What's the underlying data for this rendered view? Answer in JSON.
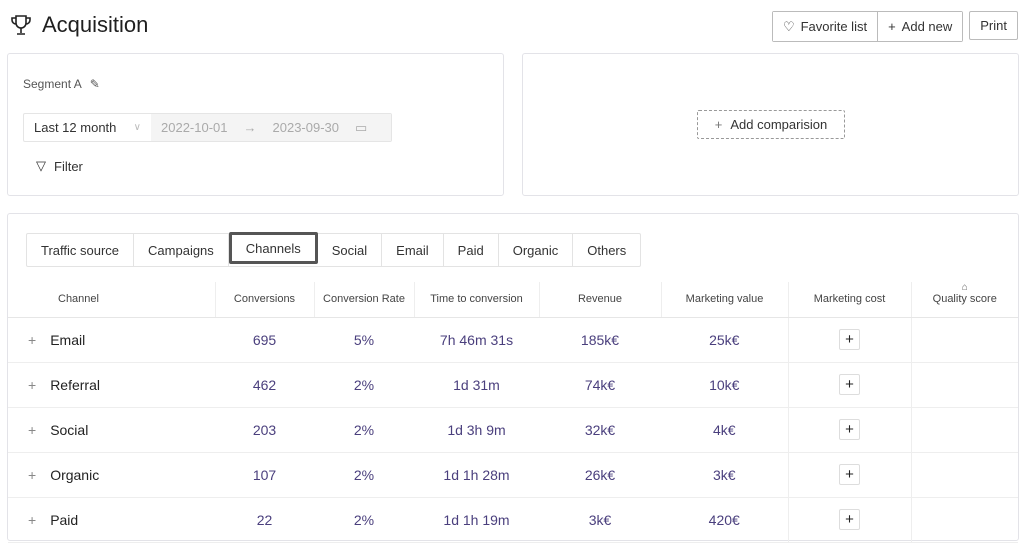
{
  "header": {
    "title": "Acquisition",
    "favorite_label": "Favorite list",
    "add_new_label": "Add new",
    "print_label": "Print"
  },
  "segment": {
    "label": "Segment A",
    "period": "Last 12 month",
    "date_from": "2022-10-01",
    "date_to": "2023-09-30",
    "filter_label": "Filter"
  },
  "comparison": {
    "add_label": "Add comparision"
  },
  "tabs": [
    "Traffic source",
    "Campaigns",
    "Channels",
    "Social",
    "Email",
    "Paid",
    "Organic",
    "Others"
  ],
  "active_tab": "Channels",
  "table": {
    "columns": [
      "Channel",
      "Conversions",
      "Conversion Rate",
      "Time to conversion",
      "Revenue",
      "Marketing value",
      "Marketing cost",
      "Quality score"
    ],
    "rows": [
      {
        "channel": "Email",
        "conversions": "695",
        "rate": "5%",
        "time": "7h 46m 31s",
        "revenue": "185k€",
        "value": "25k€"
      },
      {
        "channel": "Referral",
        "conversions": "462",
        "rate": "2%",
        "time": "1d 31m",
        "revenue": "74k€",
        "value": "10k€"
      },
      {
        "channel": "Social",
        "conversions": "203",
        "rate": "2%",
        "time": "1d 3h 9m",
        "revenue": "32k€",
        "value": "4k€"
      },
      {
        "channel": "Organic",
        "conversions": "107",
        "rate": "2%",
        "time": "1d 1h 28m",
        "revenue": "26k€",
        "value": "3k€"
      },
      {
        "channel": "Paid",
        "conversions": "22",
        "rate": "2%",
        "time": "1d 1h 19m",
        "revenue": "3k€",
        "value": "420€"
      }
    ]
  },
  "colors": {
    "value_text": "#4a3f7d",
    "border": "#e3e3e8"
  }
}
